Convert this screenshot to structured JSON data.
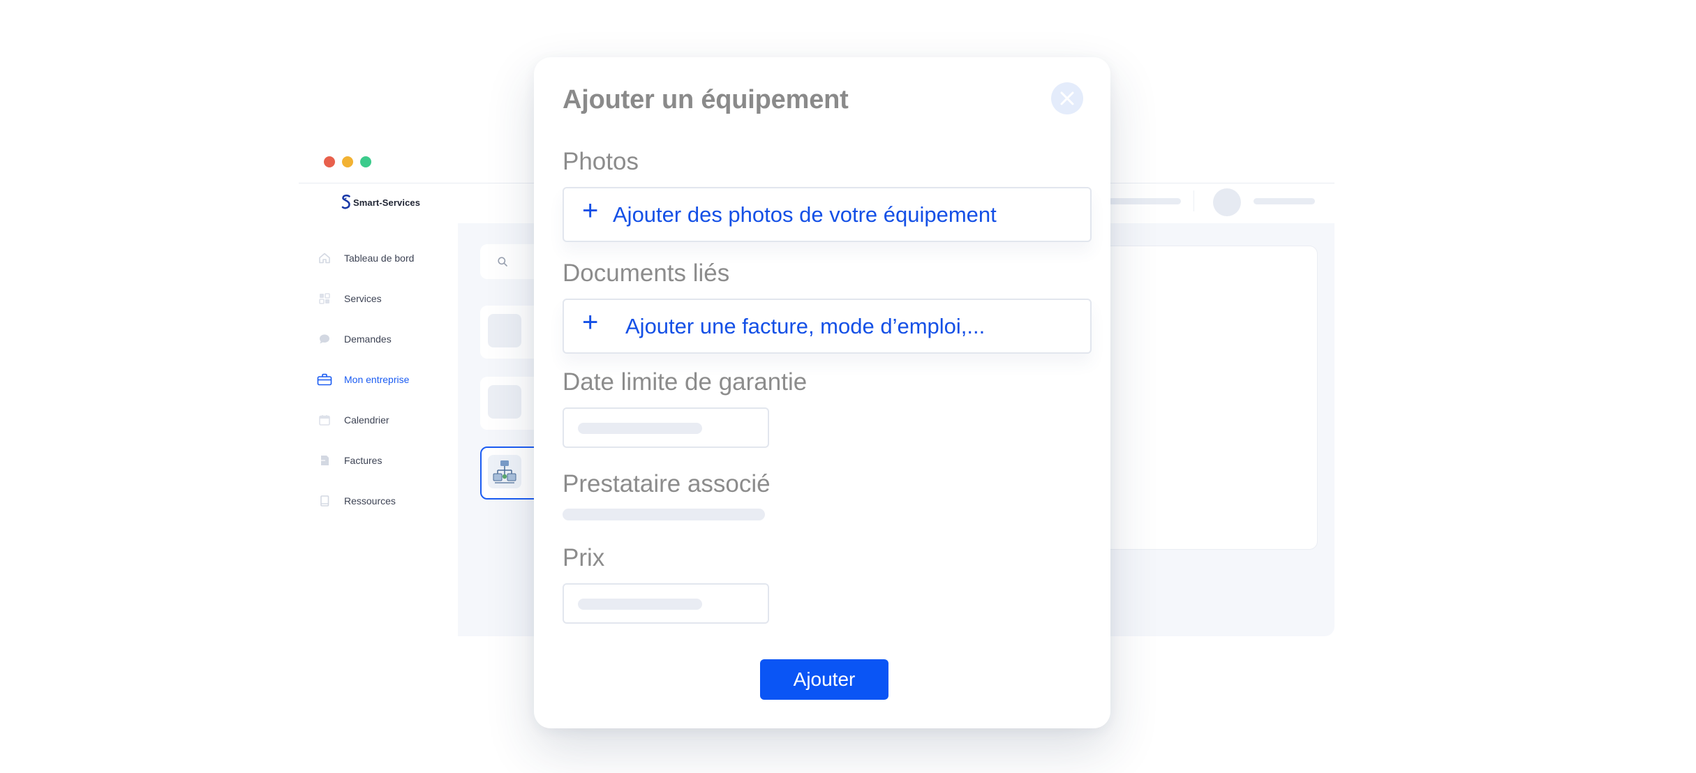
{
  "window": {
    "dots": [
      {
        "name": "close-dot",
        "color": "#e8604c"
      },
      {
        "name": "minimize-dot",
        "color": "#f2b233"
      },
      {
        "name": "maximize-dot",
        "color": "#3ccb8c"
      }
    ]
  },
  "brand": {
    "name": "Smart-Services",
    "logo_icon": "s-logo-icon",
    "color": "#1b3aa8"
  },
  "sidebar": {
    "items": [
      {
        "label": "Tableau de bord",
        "icon": "home-icon",
        "active": false
      },
      {
        "label": "Services",
        "icon": "grid-icon",
        "active": false
      },
      {
        "label": "Demandes",
        "icon": "chat-icon",
        "active": false
      },
      {
        "label": "Mon entreprise",
        "icon": "briefcase-icon",
        "active": true
      },
      {
        "label": "Calendrier",
        "icon": "calendar-icon",
        "active": false
      },
      {
        "label": "Factures",
        "icon": "invoice-icon",
        "active": false
      },
      {
        "label": "Ressources",
        "icon": "book-icon",
        "active": false
      }
    ]
  },
  "modal": {
    "title": "Ajouter un équipement",
    "close_icon": "close-icon",
    "photos_label": "Photos",
    "photos_action": "Ajouter des photos de votre équipement",
    "documents_label": "Documents liés",
    "documents_action": "Ajouter une facture, mode d’emploi,...",
    "plus_glyph": "+",
    "warranty_label": "Date limite de garantie",
    "provider_label": "Prestataire associé",
    "price_label": "Prix",
    "submit_label": "Ajouter"
  },
  "colors": {
    "accent": "#0a55f5",
    "link": "#1450e6",
    "label": "#8c8c8c"
  }
}
